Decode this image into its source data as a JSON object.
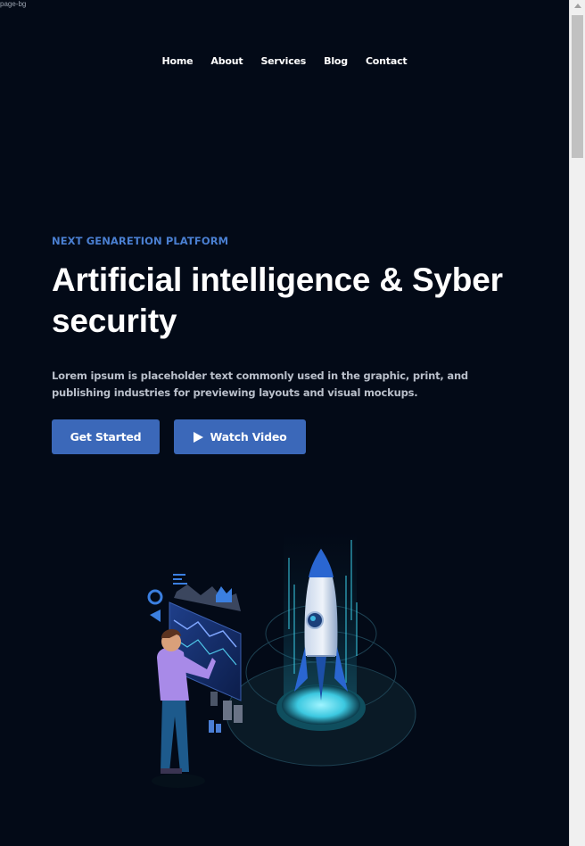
{
  "broken_image_text": "page-bg",
  "nav": {
    "items": [
      {
        "label": "Home"
      },
      {
        "label": "About"
      },
      {
        "label": "Services"
      },
      {
        "label": "Blog"
      },
      {
        "label": "Contact"
      }
    ]
  },
  "hero": {
    "eyebrow": "NEXT GENARETION PLATFORM",
    "title_line1": "Artificial intelligence & Syber",
    "title_line2": "security",
    "description_line1": "Lorem ipsum is placeholder text commonly used in the graphic, print, and",
    "description_line2": "publishing industries for previewing layouts and visual mockups.",
    "primary_button": "Get Started",
    "secondary_button": "Watch Video"
  },
  "colors": {
    "background": "#030a17",
    "accent": "#3b68b9",
    "eyebrow": "#4a7fd1"
  }
}
